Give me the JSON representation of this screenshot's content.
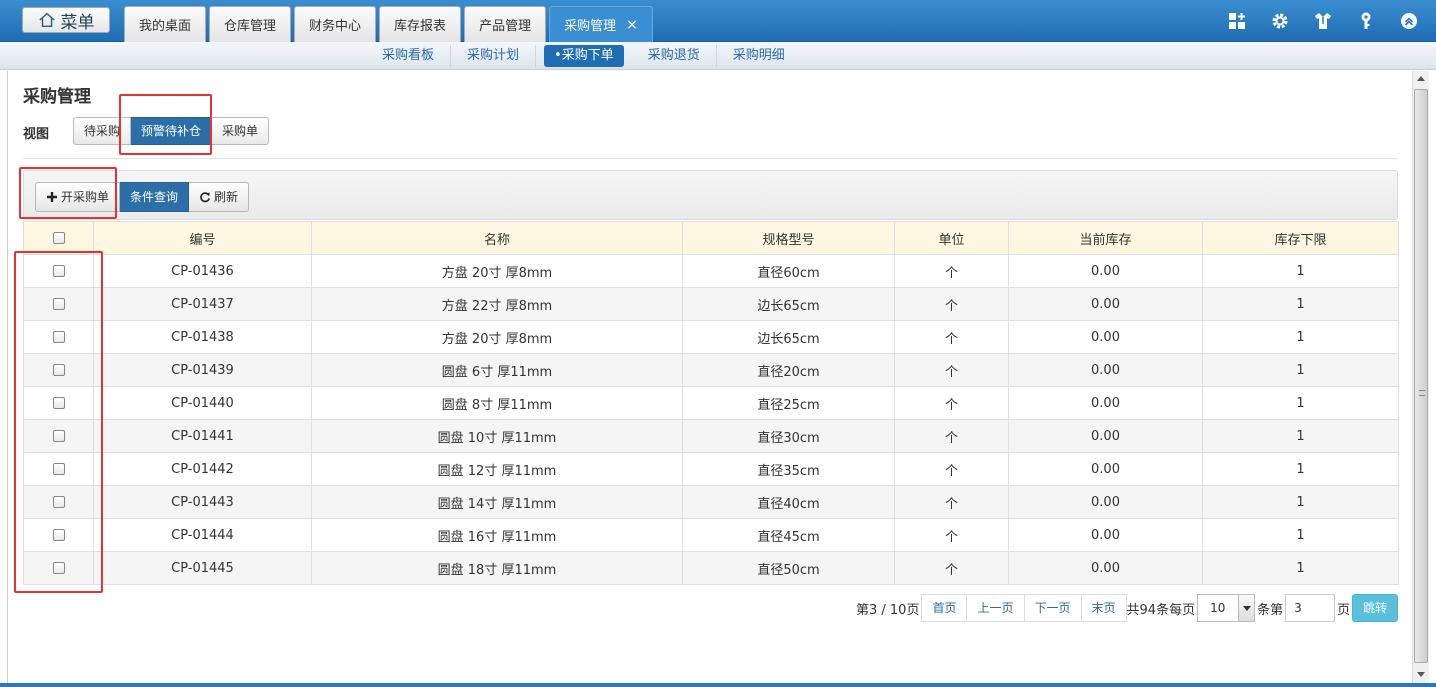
{
  "topbar": {
    "menu_label": "菜单",
    "tabs": [
      {
        "label": "我的桌面"
      },
      {
        "label": "仓库管理"
      },
      {
        "label": "财务中心"
      },
      {
        "label": "库存报表"
      },
      {
        "label": "产品管理"
      },
      {
        "label": "采购管理",
        "active": true
      }
    ],
    "close_glyph": "×",
    "icons": [
      "dashboard-icon",
      "gear-icon",
      "shirt-icon",
      "key-icon",
      "collapse-icon"
    ]
  },
  "subnav": {
    "items": [
      {
        "label": "采购看板"
      },
      {
        "label": "采购计划"
      },
      {
        "label": "•采购下单",
        "active": true
      },
      {
        "label": "采购退货"
      },
      {
        "label": "采购明细"
      }
    ]
  },
  "page": {
    "title": "采购管理",
    "view_label": "视图",
    "views": [
      {
        "label": "待采购"
      },
      {
        "label": "预警待补仓",
        "active": true
      },
      {
        "label": "采购单"
      }
    ]
  },
  "toolbar": {
    "open_order_label": "开采购单",
    "query_label": "条件查询",
    "refresh_label": "刷新"
  },
  "table": {
    "columns": [
      "编号",
      "名称",
      "规格型号",
      "单位",
      "当前库存",
      "库存下限"
    ],
    "rows": [
      {
        "code": "CP-01436",
        "name": "方盘 20寸 厚8mm",
        "spec": "直径60cm",
        "unit": "个",
        "stock": "0.00",
        "min": "1"
      },
      {
        "code": "CP-01437",
        "name": "方盘 22寸 厚8mm",
        "spec": "边长65cm",
        "unit": "个",
        "stock": "0.00",
        "min": "1"
      },
      {
        "code": "CP-01438",
        "name": "方盘 20寸 厚8mm",
        "spec": "边长65cm",
        "unit": "个",
        "stock": "0.00",
        "min": "1"
      },
      {
        "code": "CP-01439",
        "name": "圆盘 6寸 厚11mm",
        "spec": "直径20cm",
        "unit": "个",
        "stock": "0.00",
        "min": "1"
      },
      {
        "code": "CP-01440",
        "name": "圆盘 8寸 厚11mm",
        "spec": "直径25cm",
        "unit": "个",
        "stock": "0.00",
        "min": "1"
      },
      {
        "code": "CP-01441",
        "name": "圆盘 10寸 厚11mm",
        "spec": "直径30cm",
        "unit": "个",
        "stock": "0.00",
        "min": "1"
      },
      {
        "code": "CP-01442",
        "name": "圆盘 12寸 厚11mm",
        "spec": "直径35cm",
        "unit": "个",
        "stock": "0.00",
        "min": "1"
      },
      {
        "code": "CP-01443",
        "name": "圆盘 14寸 厚11mm",
        "spec": "直径40cm",
        "unit": "个",
        "stock": "0.00",
        "min": "1"
      },
      {
        "code": "CP-01444",
        "name": "圆盘 16寸 厚11mm",
        "spec": "直径45cm",
        "unit": "个",
        "stock": "0.00",
        "min": "1"
      },
      {
        "code": "CP-01445",
        "name": "圆盘 18寸 厚11mm",
        "spec": "直径50cm",
        "unit": "个",
        "stock": "0.00",
        "min": "1"
      }
    ]
  },
  "pager": {
    "page_info": "第3 / 10页",
    "first": "首页",
    "prev": "上一页",
    "next": "下一页",
    "last": "末页",
    "total_text": "共94条每页",
    "page_size": "10",
    "jump_prefix": "条第",
    "page_value": "3",
    "jump_suffix": "页",
    "go_label": "跳转"
  },
  "colors": {
    "accent": "#1f6db3",
    "header_bg": "#fdf7e1",
    "highlight": "#e53333"
  }
}
